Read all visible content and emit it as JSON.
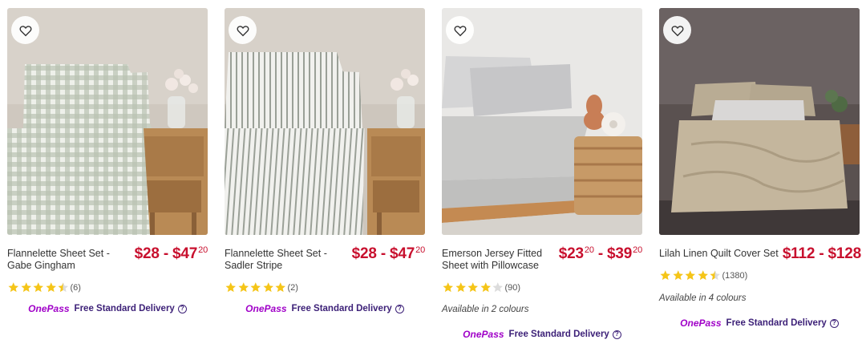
{
  "products": [
    {
      "title": "Flannelette Sheet Set - Gabe Gingham",
      "price_from": "$28",
      "price_sep": " - ",
      "price_to": "$47",
      "price_to_cents": "20",
      "rating": 4.5,
      "review_count": "(6)",
      "colours_text": "",
      "delivery_brand": "OnePass",
      "delivery_text": "Free Standard Delivery",
      "image": "gingham-sheet-bedroom-photo"
    },
    {
      "title": "Flannelette Sheet Set - Sadler Stripe",
      "price_from": "$28",
      "price_sep": " - ",
      "price_to": "$47",
      "price_to_cents": "20",
      "rating": 5,
      "review_count": "(2)",
      "colours_text": "",
      "delivery_brand": "OnePass",
      "delivery_text": "Free Standard Delivery",
      "image": "striped-sheet-bedroom-photo"
    },
    {
      "title": "Emerson Jersey Fitted Sheet with Pillowcase",
      "price_from": "$23",
      "price_from_cents": "20",
      "price_sep": " - ",
      "price_to": "$39",
      "price_to_cents": "20",
      "rating": 4,
      "review_count": "(90)",
      "colours_text": "Available in 2 colours",
      "delivery_brand": "OnePass",
      "delivery_text": "Free Standard Delivery",
      "image": "grey-jersey-sheet-bedroom-photo"
    },
    {
      "title": "Lilah Linen Quilt Cover Set",
      "price_from": "$112",
      "price_sep": " - ",
      "price_to": "$128",
      "rating": 4.5,
      "review_count": "(1380)",
      "colours_text": "Available in 4 colours",
      "delivery_brand": "OnePass",
      "delivery_text": "Free Standard Delivery",
      "image": "linen-quilt-bedroom-photo"
    }
  ],
  "icons": {
    "favourite": "heart-outline-icon",
    "star": "star-icon",
    "help": "question-circle-icon"
  },
  "colors": {
    "price": "#c8102e",
    "star": "#f5c518",
    "onepass": "#a000c8",
    "delivery": "#3d2178"
  }
}
